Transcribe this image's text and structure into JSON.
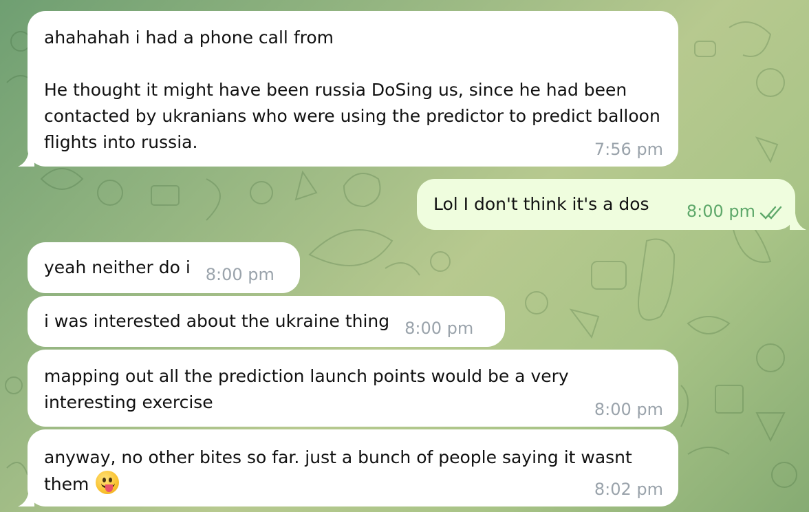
{
  "messages": [
    {
      "text": "ahahahah i had a phone call from\n\nHe thought it might have been russia DoSing us, since he had been contacted by ukranians who were using the predictor to predict balloon flights into russia.",
      "time": "7:56 pm"
    },
    {
      "text": "Lol I don't think it's a dos",
      "time": "8:00 pm",
      "status": "read-double-check-icon"
    },
    {
      "text": "yeah neither do i",
      "time": "8:00 pm"
    },
    {
      "text": "i was interested about the ukraine thing",
      "time": "8:00 pm"
    },
    {
      "text": "mapping out all the prediction launch points would be a very interesting exercise",
      "time": "8:00 pm"
    },
    {
      "text": "anyway, no other bites so far. just a bunch of people saying it wasnt them",
      "time": "8:02 pm",
      "emoji": "face-with-tongue-emoji"
    }
  ],
  "colors": {
    "incoming_bubble": "#ffffff",
    "outgoing_bubble": "#effdde",
    "outgoing_time": "#5ea86a",
    "incoming_time": "#9aa3ab"
  }
}
